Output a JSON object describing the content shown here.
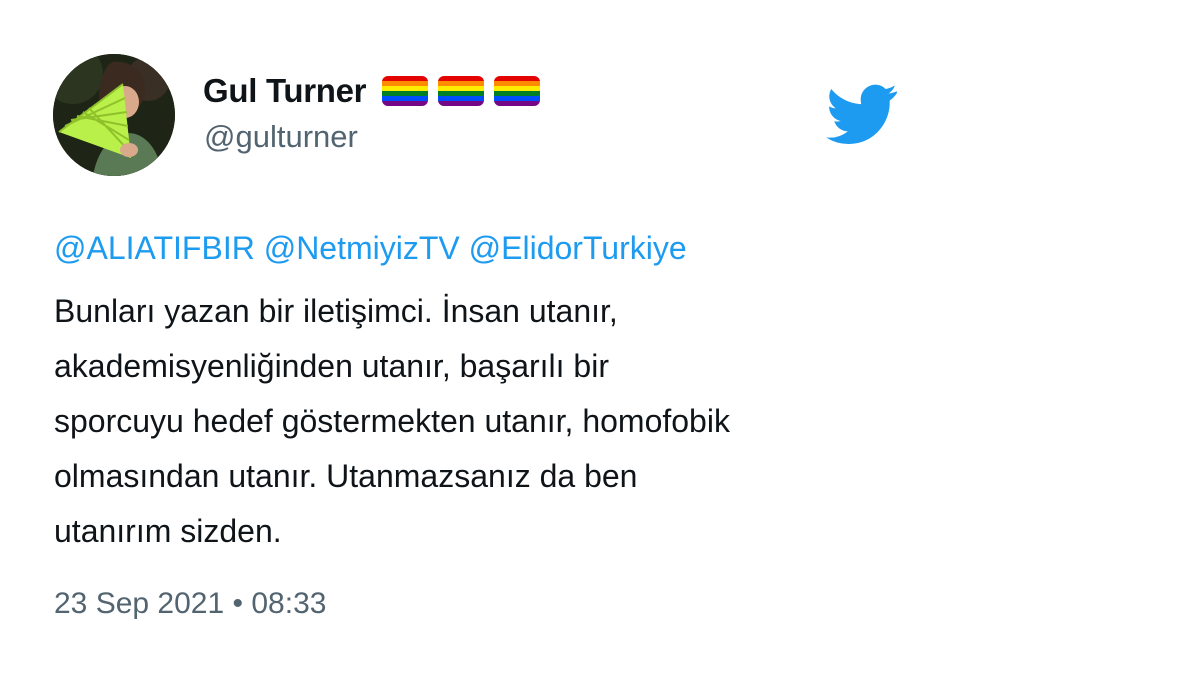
{
  "author": {
    "display_name": "Gul Turner",
    "handle": "@gulturner",
    "badges": [
      "rainbow-flag-icon",
      "rainbow-flag-icon",
      "rainbow-flag-icon"
    ]
  },
  "brand": {
    "icon": "twitter-bird-icon",
    "color": "#1d9bf0"
  },
  "tweet": {
    "mentions": [
      "@ALIATIFBIR",
      "@NetmiyizTV",
      "@ElidorTurkiye"
    ],
    "text_lines": [
      "Bunları yazan bir iletişimci. İnsan utanır,",
      "akademisyenliğinden utanır, başarılı bir",
      "sporcuyu hedef göstermekten utanır, homofobik",
      "olmasından utanır. Utanmazsanız da ben",
      "utanırım sizden."
    ],
    "date": "23 Sep 2021",
    "separator": "•",
    "time": "08:33"
  },
  "colors": {
    "text": "#0f1419",
    "secondary": "#536471",
    "link": "#1d9bf0",
    "rainbow": [
      "#e40303",
      "#ff8c00",
      "#ffed00",
      "#008026",
      "#004dff",
      "#750787"
    ]
  }
}
